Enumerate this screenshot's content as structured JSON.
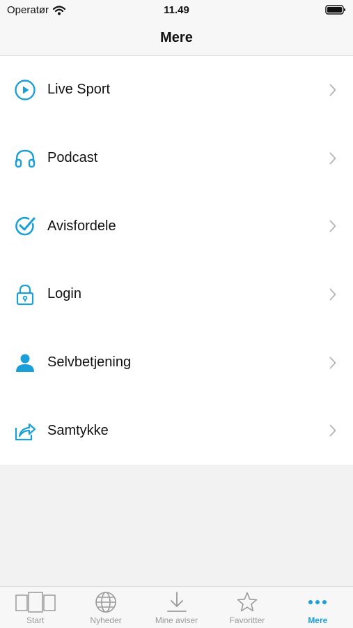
{
  "status_bar": {
    "carrier": "Operatør",
    "time": "11.49"
  },
  "header": {
    "title": "Mere"
  },
  "menu": {
    "items": [
      {
        "label": "Live Sport",
        "icon": "play-circle-icon"
      },
      {
        "label": "Podcast",
        "icon": "headphones-icon"
      },
      {
        "label": "Avisfordele",
        "icon": "check-circle-icon"
      },
      {
        "label": "Login",
        "icon": "lock-icon"
      },
      {
        "label": "Selvbetjening",
        "icon": "person-icon"
      },
      {
        "label": "Samtykke",
        "icon": "share-icon"
      }
    ]
  },
  "tab_bar": {
    "tabs": [
      {
        "label": "Start",
        "icon": "pages-icon",
        "active": false
      },
      {
        "label": "Nyheder",
        "icon": "globe-icon",
        "active": false
      },
      {
        "label": "Mine aviser",
        "icon": "download-icon",
        "active": false
      },
      {
        "label": "Favoritter",
        "icon": "star-icon",
        "active": false
      },
      {
        "label": "Mere",
        "icon": "more-dots-icon",
        "active": true
      }
    ]
  },
  "colors": {
    "accent": "#1a9fd8",
    "inactive": "#9a9a9a",
    "background": "#f2f2f2"
  }
}
